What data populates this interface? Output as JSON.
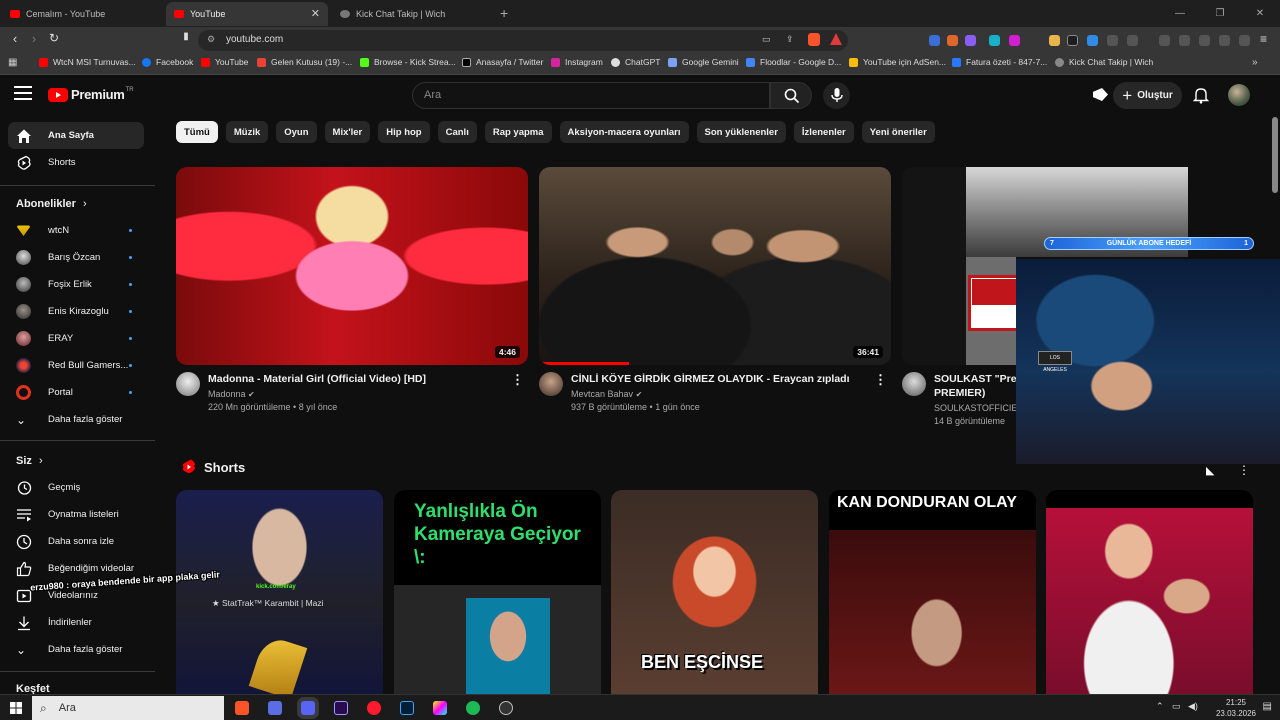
{
  "browser": {
    "tabs": [
      {
        "title": "Cemalım - YouTube",
        "active": false
      },
      {
        "title": "YouTube",
        "active": true
      },
      {
        "title": "Kick Chat Takip | Wich",
        "active": false
      }
    ],
    "url": "youtube.com",
    "bookmarks": [
      {
        "label": "WtcN MSI Turnuvas...",
        "icon": "youtube-icon"
      },
      {
        "label": "Facebook",
        "icon": "facebook-icon"
      },
      {
        "label": "YouTube",
        "icon": "youtube-icon"
      },
      {
        "label": "Gelen Kutusu (19) -...",
        "icon": "gmail-icon"
      },
      {
        "label": "Browse - Kick Strea...",
        "icon": "kick-icon"
      },
      {
        "label": "Anasayfa / Twitter",
        "icon": "x-icon"
      },
      {
        "label": "Instagram",
        "icon": "instagram-icon"
      },
      {
        "label": "ChatGPT",
        "icon": "chatgpt-icon"
      },
      {
        "label": "Google Gemini",
        "icon": "gemini-icon"
      },
      {
        "label": "Floodlar - Google D...",
        "icon": "docs-icon"
      },
      {
        "label": "YouTube için AdSen...",
        "icon": "adsense-icon"
      },
      {
        "label": "Fatura özeti - 847-7...",
        "icon": "bill-icon"
      },
      {
        "label": "Kick Chat Takip | Wich",
        "icon": "globe-icon"
      }
    ]
  },
  "youtube": {
    "logo_text": "Premium",
    "logo_sup": "TR",
    "search_placeholder": "Ara",
    "create_label": "Oluştur",
    "chips": [
      "Tümü",
      "Müzik",
      "Oyun",
      "Mix'ler",
      "Hip hop",
      "Canlı",
      "Rap yapma",
      "Aksiyon-macera oyunları",
      "Son yüklenenler",
      "İzlenenler",
      "Yeni öneriler"
    ],
    "sidebar": {
      "home": "Ana Sayfa",
      "shorts": "Shorts",
      "subs_heading": "Abonelikler",
      "subscriptions": [
        "wtcN",
        "Barış Özcan",
        "Foşix Erlik",
        "Enis Kirazoglu",
        "ERAY",
        "Red Bull Gamers...",
        "Portal"
      ],
      "show_more": "Daha fazla göster",
      "you_heading": "Siz",
      "you_items": [
        "Geçmiş",
        "Oynatma listeleri",
        "Daha sonra izle",
        "Beğendiğim videolar",
        "Videolarınız",
        "İndirilenler",
        "Daha fazla göster"
      ],
      "explore_heading": "Keşfet"
    },
    "videos": [
      {
        "title": "Madonna - Material Girl (Official Video) [HD]",
        "channel": "Madonna",
        "stats": "220 Mn görüntüleme • 8 yıl önce",
        "duration": "4:46"
      },
      {
        "title": "CİNLİ KÖYE GİRDİK GİRMEZ OLAYDIK - Eraycan zıpladı",
        "channel": "Mevtcan Bahav",
        "stats": "937 B görüntüleme • 1 gün önce",
        "duration": "36:41"
      },
      {
        "title": "SOULKAST \"Prem",
        "title2": "PREMIER)",
        "channel": "SOULKASTOFFICIE",
        "stats": "14 B görüntüleme"
      }
    ],
    "shorts_heading": "Shorts",
    "shorts": [
      {
        "caption": "★ StatTrak™ Karambit | Mazi",
        "tag": "kick.com/eray"
      },
      {
        "caption": "Yanlışlıkla Ön Kameraya Geçiyor \\:"
      },
      {
        "caption": "BEN EŞCİNSE"
      },
      {
        "caption": "KAN DONDURAN OLAY"
      },
      {
        "caption": ""
      }
    ]
  },
  "stream_overlay": {
    "goal_label": "GÜNLÜK ABONE HEDEFİ",
    "goal_left": "7",
    "goal_right": "1",
    "chat_message": "erzu980 : oraya bendende bir app plaka gelir"
  },
  "taskbar": {
    "search_placeholder": "Ara",
    "time": "21:25",
    "date": "23.03.2026"
  }
}
